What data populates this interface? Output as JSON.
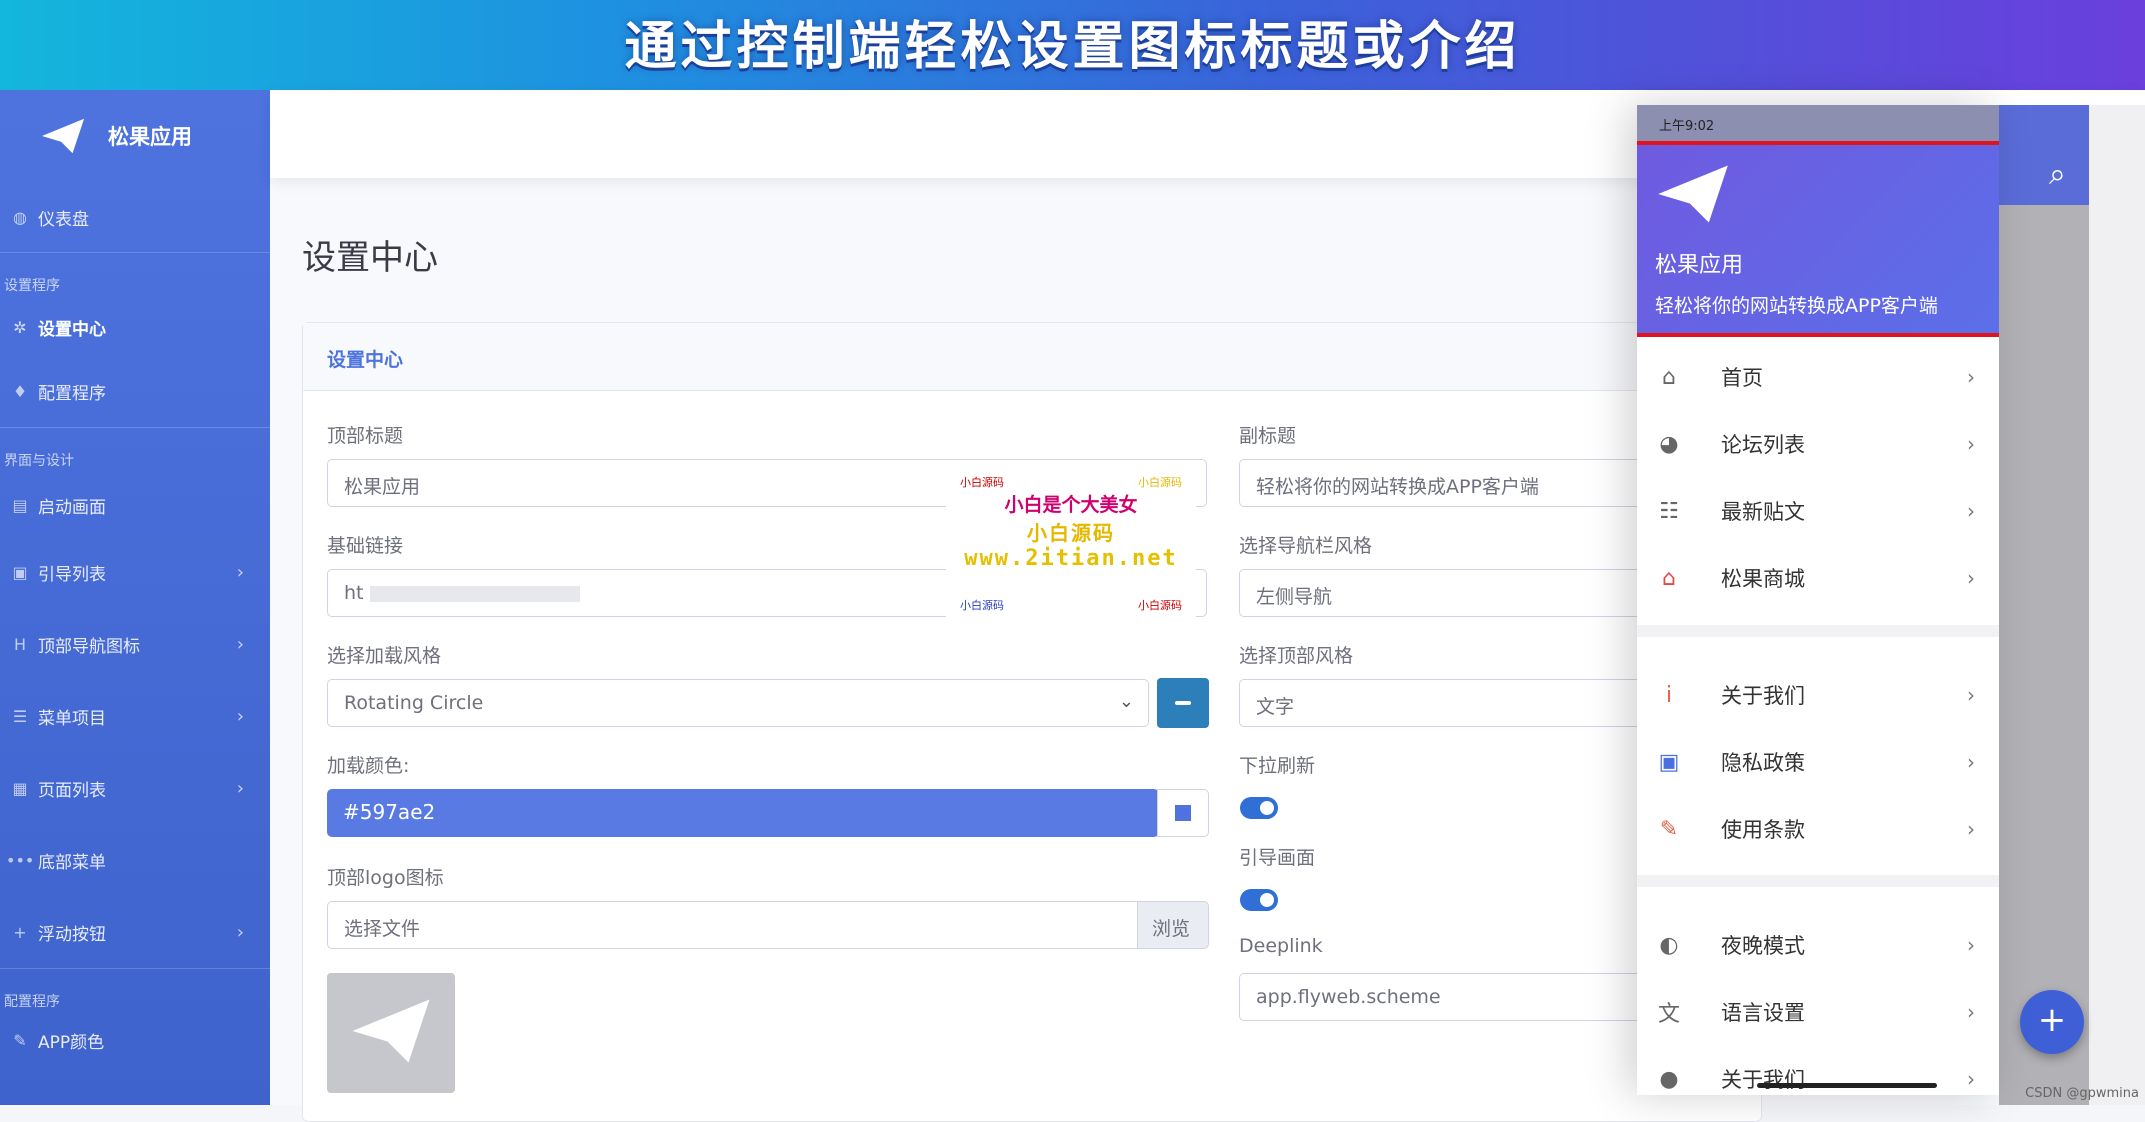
{
  "banner": {
    "title": "通过控制端轻松设置图标标题或介绍"
  },
  "sidebar": {
    "brand": "松果应用",
    "items": [
      {
        "icon": "dashboard-icon",
        "label": "仪表盘"
      },
      {
        "heading": "设置程序"
      },
      {
        "icon": "gears-icon",
        "label": "设置中心",
        "active": true
      },
      {
        "icon": "wrench-icon",
        "label": "配置程序"
      },
      {
        "heading": "界面与设计"
      },
      {
        "icon": "layers-icon",
        "label": "启动画面"
      },
      {
        "icon": "image-icon",
        "label": "引导列表"
      },
      {
        "icon": "header-icon",
        "label": "顶部导航图标"
      },
      {
        "icon": "list-icon",
        "label": "菜单项目"
      },
      {
        "icon": "files-icon",
        "label": "页面列表"
      },
      {
        "icon": "dots-icon",
        "label": "底部菜单"
      },
      {
        "icon": "plus-icon",
        "label": "浮动按钮"
      },
      {
        "heading": "配置程序"
      },
      {
        "icon": "brush-icon",
        "label": "APP颜色"
      }
    ]
  },
  "main": {
    "page_title": "设置中心",
    "card_title": "设置中心",
    "left": {
      "top_title_label": "顶部标题",
      "top_title_value": "松果应用",
      "base_link_label": "基础链接",
      "base_link_value": "ht",
      "loader_style_label": "选择加载风格",
      "loader_style_value": "Rotating Circle",
      "loader_color_label": "加载颜色:",
      "loader_color_value": "#597ae2",
      "logo_label": "顶部logo图标",
      "logo_file_placeholder": "选择文件",
      "logo_browse": "浏览"
    },
    "right": {
      "subtitle_label": "副标题",
      "subtitle_value": "轻松将你的网站转换成APP客户端",
      "nav_style_label": "选择导航栏风格",
      "nav_style_value": "左侧导航",
      "top_style_label": "选择顶部风格",
      "top_style_value": "文字",
      "pull_refresh_label": "下拉刷新",
      "guide_label": "引导画面",
      "deeplink_label": "Deeplink",
      "deeplink_value": "app.flyweb.scheme"
    }
  },
  "watermark": {
    "line1": "小白是个大美女",
    "line2": "小白源码",
    "url": "www.2itian.net",
    "tag_tl": "小白源码",
    "tag_tr": "小白源码",
    "tag_bl": "小白源码",
    "tag_br": "小白源码"
  },
  "phone": {
    "status_time": "上午9:02",
    "app_name": "松果应用",
    "app_subtitle": "轻松将你的网站转换成APP客户端",
    "menu": [
      {
        "icon": "home-icon",
        "label": "首页"
      },
      {
        "icon": "forum-icon",
        "label": "论坛列表"
      },
      {
        "icon": "posts-icon",
        "label": "最新贴文"
      },
      {
        "icon": "shop-icon",
        "label": "松果商城"
      },
      {
        "icon": "info-icon",
        "label": "关于我们"
      },
      {
        "icon": "privacy-icon",
        "label": "隐私政策"
      },
      {
        "icon": "terms-icon",
        "label": "使用条款"
      },
      {
        "icon": "night-icon",
        "label": "夜晚模式"
      },
      {
        "icon": "translate-icon",
        "label": "语言设置"
      },
      {
        "icon": "info-icon",
        "label": "关于我们"
      }
    ]
  },
  "footer": {
    "csdn": "CSDN @gpwmina"
  },
  "colors": {
    "accent": "#4e73df",
    "loader": "#597ae2",
    "red_line": "#e2131f"
  }
}
